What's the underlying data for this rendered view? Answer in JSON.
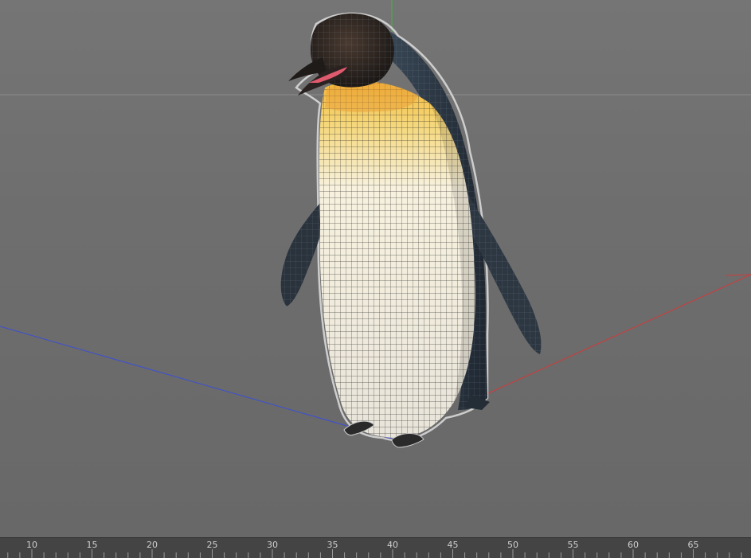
{
  "viewport": {
    "model": "penguin",
    "display_mode": "wireframe-on-shaded",
    "axes": {
      "x_color": "#d03b3b",
      "y_color": "#3fb53f",
      "z_color": "#3b4fd6"
    },
    "background_color": "#6e6e6e"
  },
  "timeline": {
    "frame_labels": [
      "10",
      "15",
      "20",
      "25",
      "30",
      "35",
      "40",
      "45",
      "50",
      "55",
      "60",
      "65"
    ]
  }
}
